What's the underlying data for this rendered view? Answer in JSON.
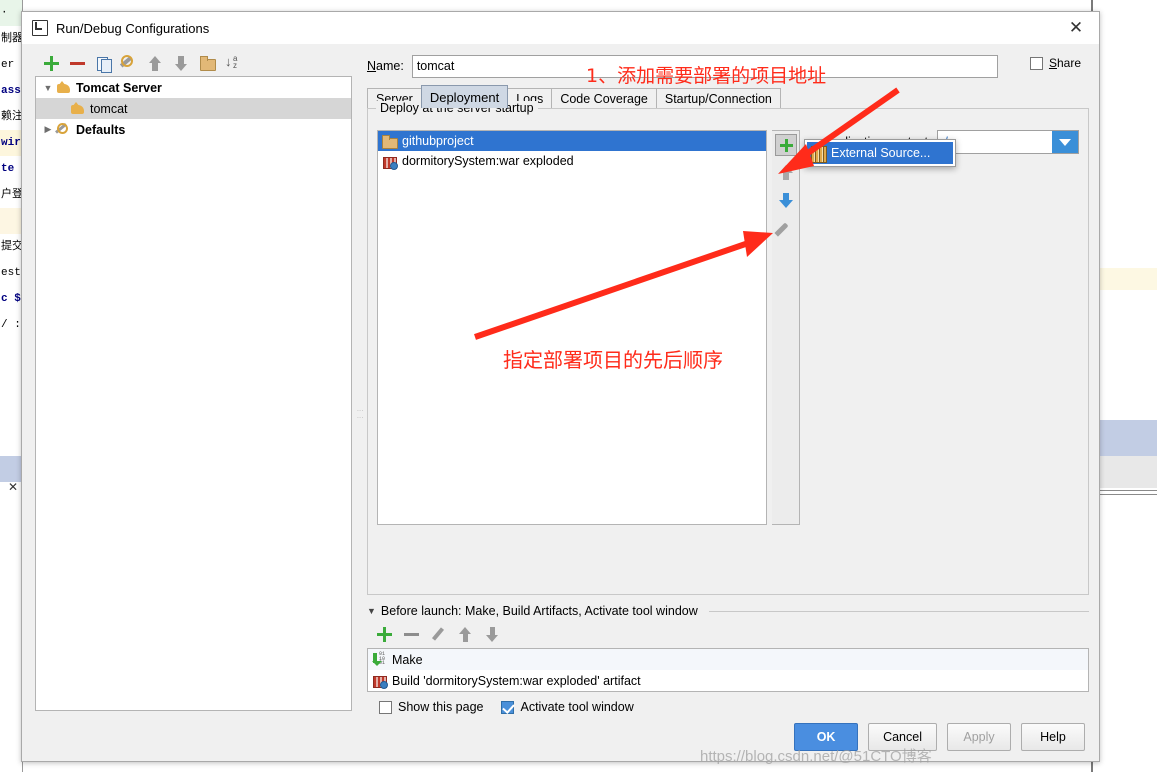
{
  "background": {
    "left_lines": [
      {
        "text": "·",
        "style": "green"
      },
      {
        "text": "制器",
        "style": ""
      },
      {
        "text": "er",
        "style": ""
      },
      {
        "text": "ass",
        "style": "kw"
      },
      {
        "text": "赖注",
        "style": ""
      },
      {
        "text": "wir",
        "style": "kw-hl"
      },
      {
        "text": "te",
        "style": "kw"
      },
      {
        "text": "户登",
        "style": ""
      },
      {
        "text": "",
        "style": "yellow"
      },
      {
        "text": "提交",
        "style": ""
      },
      {
        "text": "est",
        "style": ""
      },
      {
        "text": "c $",
        "style": "kw"
      },
      {
        "text": "/ :",
        "style": ""
      }
    ]
  },
  "dialog": {
    "title": "Run/Debug Configurations",
    "close_label": "✕"
  },
  "left_pane": {
    "toolbar": [
      {
        "name": "add",
        "icon": "plus-icon"
      },
      {
        "name": "remove",
        "icon": "minus-icon"
      },
      {
        "name": "copy",
        "icon": "copy-icon"
      },
      {
        "name": "edit-templates",
        "icon": "wrench-icon"
      },
      {
        "name": "move-up",
        "icon": "arrow-up-icon"
      },
      {
        "name": "move-down",
        "icon": "arrow-down-icon"
      },
      {
        "name": "new-folder",
        "icon": "folder-icon"
      },
      {
        "name": "sort",
        "icon": "sort-az-icon"
      }
    ],
    "tree": [
      {
        "label": "Tomcat Server",
        "level": 0,
        "expanded": true,
        "icon": "tomcat-icon",
        "selected": false,
        "toggle": "▼"
      },
      {
        "label": "tomcat",
        "level": 1,
        "expanded": false,
        "icon": "tomcat-icon",
        "selected": true,
        "toggle": ""
      },
      {
        "label": "Defaults",
        "level": 0,
        "expanded": false,
        "icon": "wrench-icon",
        "selected": false,
        "toggle": "▶"
      }
    ]
  },
  "right_pane": {
    "name_label": "Name:",
    "name_label_mnemonic": "N",
    "name_value": "tomcat",
    "name_placeholder": "",
    "share": {
      "label": "Share",
      "checked": false,
      "mnemonic": "S"
    },
    "tabs": [
      {
        "label": "Server",
        "active": false
      },
      {
        "label": "Deployment",
        "active": true
      },
      {
        "label": "Logs",
        "active": false
      },
      {
        "label": "Code Coverage",
        "active": false
      },
      {
        "label": "Startup/Connection",
        "active": false
      }
    ],
    "group_title": "Deploy at the server startup",
    "deploy_items": [
      {
        "label": "githubproject",
        "icon": "folder-icon",
        "selected": true
      },
      {
        "label": "dormitorySystem:war exploded",
        "icon": "artifact-icon",
        "selected": false
      }
    ],
    "list_toolbar": [
      {
        "name": "add-deployment",
        "icon": "plus-icon",
        "state": "pressed"
      },
      {
        "name": "move-up",
        "icon": "arrow-up-icon",
        "state": "disabled"
      },
      {
        "name": "move-down",
        "icon": "arrow-down-icon",
        "state": "enabled"
      },
      {
        "name": "edit",
        "icon": "pencil-icon",
        "state": "enabled"
      }
    ],
    "popup_menu": [
      {
        "label": "External Source...",
        "icon": "external-source-icon",
        "highlighted": true
      }
    ],
    "app_context": {
      "label": "Application context:",
      "value": "/",
      "arrow": "▼"
    }
  },
  "before_launch": {
    "title": "Before launch: Make, Build Artifacts, Activate tool window",
    "title_mnemonic": "B",
    "triangle": "▼",
    "toolbar": [
      {
        "name": "add-task",
        "icon": "plus-icon"
      },
      {
        "name": "remove-task",
        "icon": "minus-icon"
      },
      {
        "name": "edit-task",
        "icon": "pencil-icon"
      },
      {
        "name": "move-task-up",
        "icon": "arrow-up-icon"
      },
      {
        "name": "move-task-down",
        "icon": "arrow-down-icon"
      }
    ],
    "tasks": [
      {
        "label": "Make",
        "icon": "make-icon"
      },
      {
        "label": "Build 'dormitorySystem:war exploded' artifact",
        "icon": "artifact-icon"
      }
    ],
    "options": [
      {
        "label": "Show this page",
        "checked": false
      },
      {
        "label": "Activate tool window",
        "checked": true
      }
    ]
  },
  "buttons": [
    {
      "label": "OK",
      "style": "primary",
      "disabled": false
    },
    {
      "label": "Cancel",
      "style": "normal",
      "disabled": false
    },
    {
      "label": "Apply",
      "style": "normal",
      "disabled": true
    },
    {
      "label": "Help",
      "style": "normal",
      "disabled": false
    }
  ],
  "annotations": {
    "top": "1、添加需要部署的项目地址",
    "middle": "指定部署项目的先后顺序"
  },
  "watermark": "https://blog.csdn.net/@51CTO博客",
  "colors": {
    "accent_blue": "#2f74d0",
    "annotation_red": "#ff2b1a",
    "selection_grey": "#d6d6d6",
    "dialog_bg": "#f0f0f0",
    "tab_active": "#cfd8e4",
    "green": "#3aab3a"
  }
}
